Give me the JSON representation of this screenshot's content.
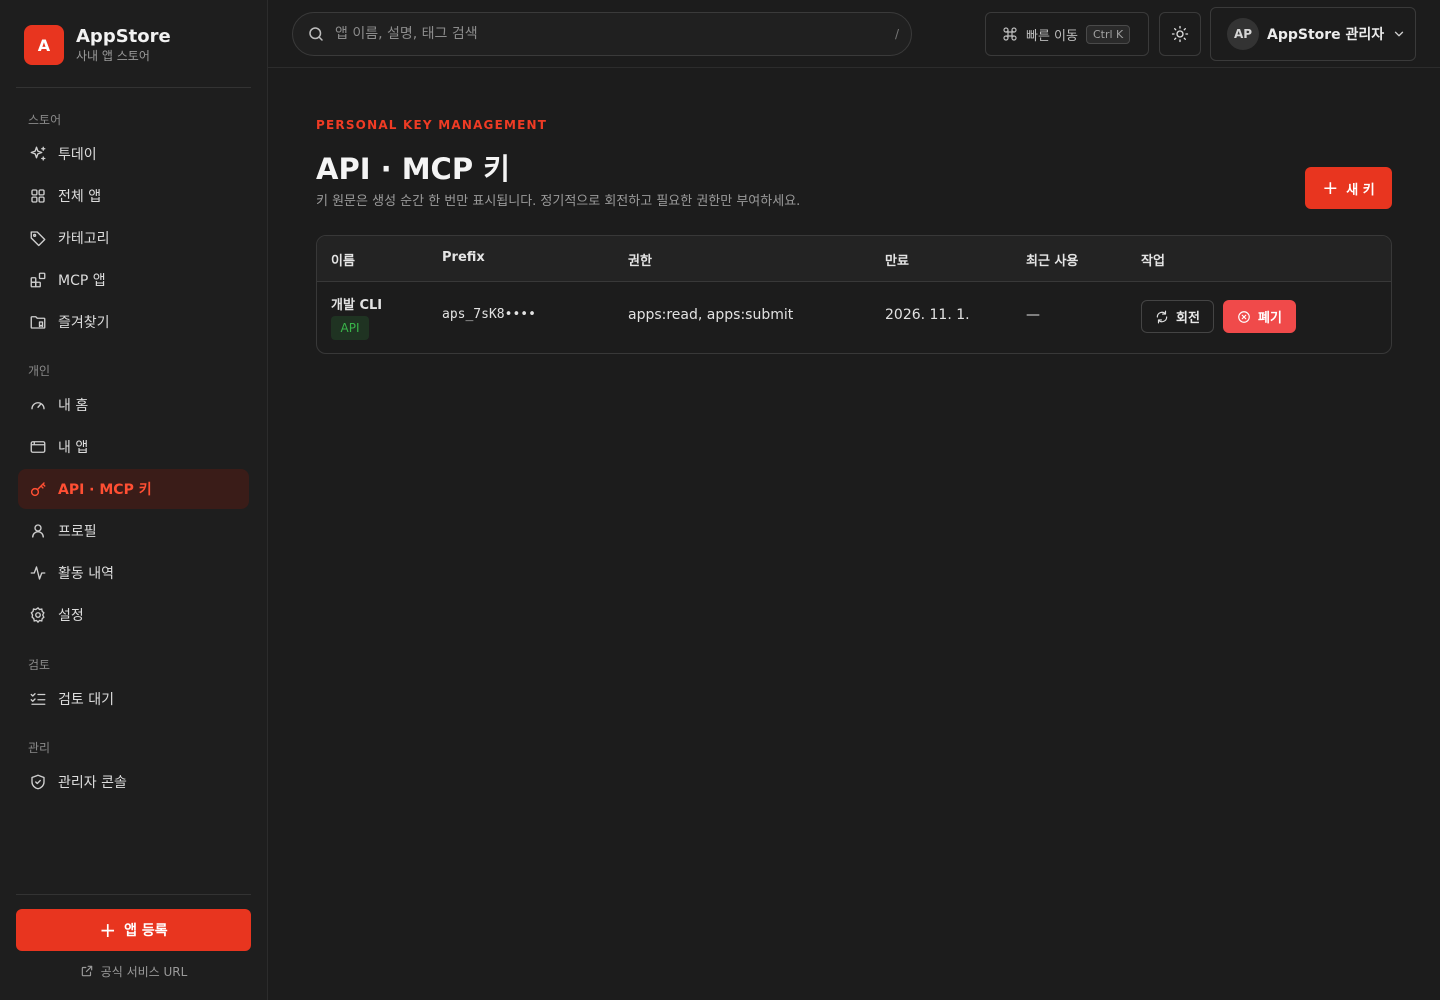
{
  "brand": {
    "logo_letter": "A",
    "name": "AppStore",
    "subtitle": "사내 앱 스토어"
  },
  "nav": {
    "sections": [
      {
        "label": "스토어",
        "items": [
          {
            "label": "투데이",
            "icon": "sparkles-icon"
          },
          {
            "label": "전체 앱",
            "icon": "grid-icon"
          },
          {
            "label": "카테고리",
            "icon": "tag-icon"
          },
          {
            "label": "MCP 앱",
            "icon": "blocks-icon"
          },
          {
            "label": "즐겨찾기",
            "icon": "folder-bookmark-icon"
          }
        ]
      },
      {
        "label": "개인",
        "items": [
          {
            "label": "내 홈",
            "icon": "gauge-icon"
          },
          {
            "label": "내 앱",
            "icon": "app-window-icon"
          },
          {
            "label": "API · MCP 키",
            "icon": "key-icon",
            "active": true
          },
          {
            "label": "프로필",
            "icon": "user-icon"
          },
          {
            "label": "활동 내역",
            "icon": "activity-icon"
          },
          {
            "label": "설정",
            "icon": "gear-icon"
          }
        ]
      },
      {
        "label": "검토",
        "items": [
          {
            "label": "검토 대기",
            "icon": "list-checks-icon"
          }
        ]
      },
      {
        "label": "관리",
        "items": [
          {
            "label": "관리자 콘솔",
            "icon": "shield-icon"
          }
        ]
      }
    ],
    "register_label": "앱 등록",
    "official_link_label": "공식 서비스 URL"
  },
  "topbar": {
    "search_placeholder": "앱 이름, 설명, 태그 검색",
    "search_shortcut": "/",
    "quick_label": "빠른 이동",
    "quick_kbd": "Ctrl K",
    "user_initials": "AP",
    "user_name": "AppStore 관리자"
  },
  "page": {
    "eyebrow": "PERSONAL KEY MANAGEMENT",
    "title": "API · MCP 키",
    "description": "키 원문은 생성 순간 한 번만 표시됩니다. 정기적으로 회전하고 필요한 권한만 부여하세요.",
    "new_key_label": "새 키"
  },
  "table": {
    "headers": [
      "이름",
      "Prefix",
      "권한",
      "만료",
      "최근 사용",
      "작업"
    ],
    "rows": [
      {
        "name": "개발 CLI",
        "badge": "API",
        "prefix": "aps_7sK8••••",
        "scopes": "apps:read, apps:submit",
        "expires": "2026. 11. 1.",
        "last_used": "—",
        "rotate_label": "회전",
        "revoke_label": "폐기"
      }
    ]
  },
  "colors": {
    "accent": "#e8351f",
    "danger": "#f04a4a",
    "success": "#39b54a",
    "background": "#1c1c1c"
  }
}
